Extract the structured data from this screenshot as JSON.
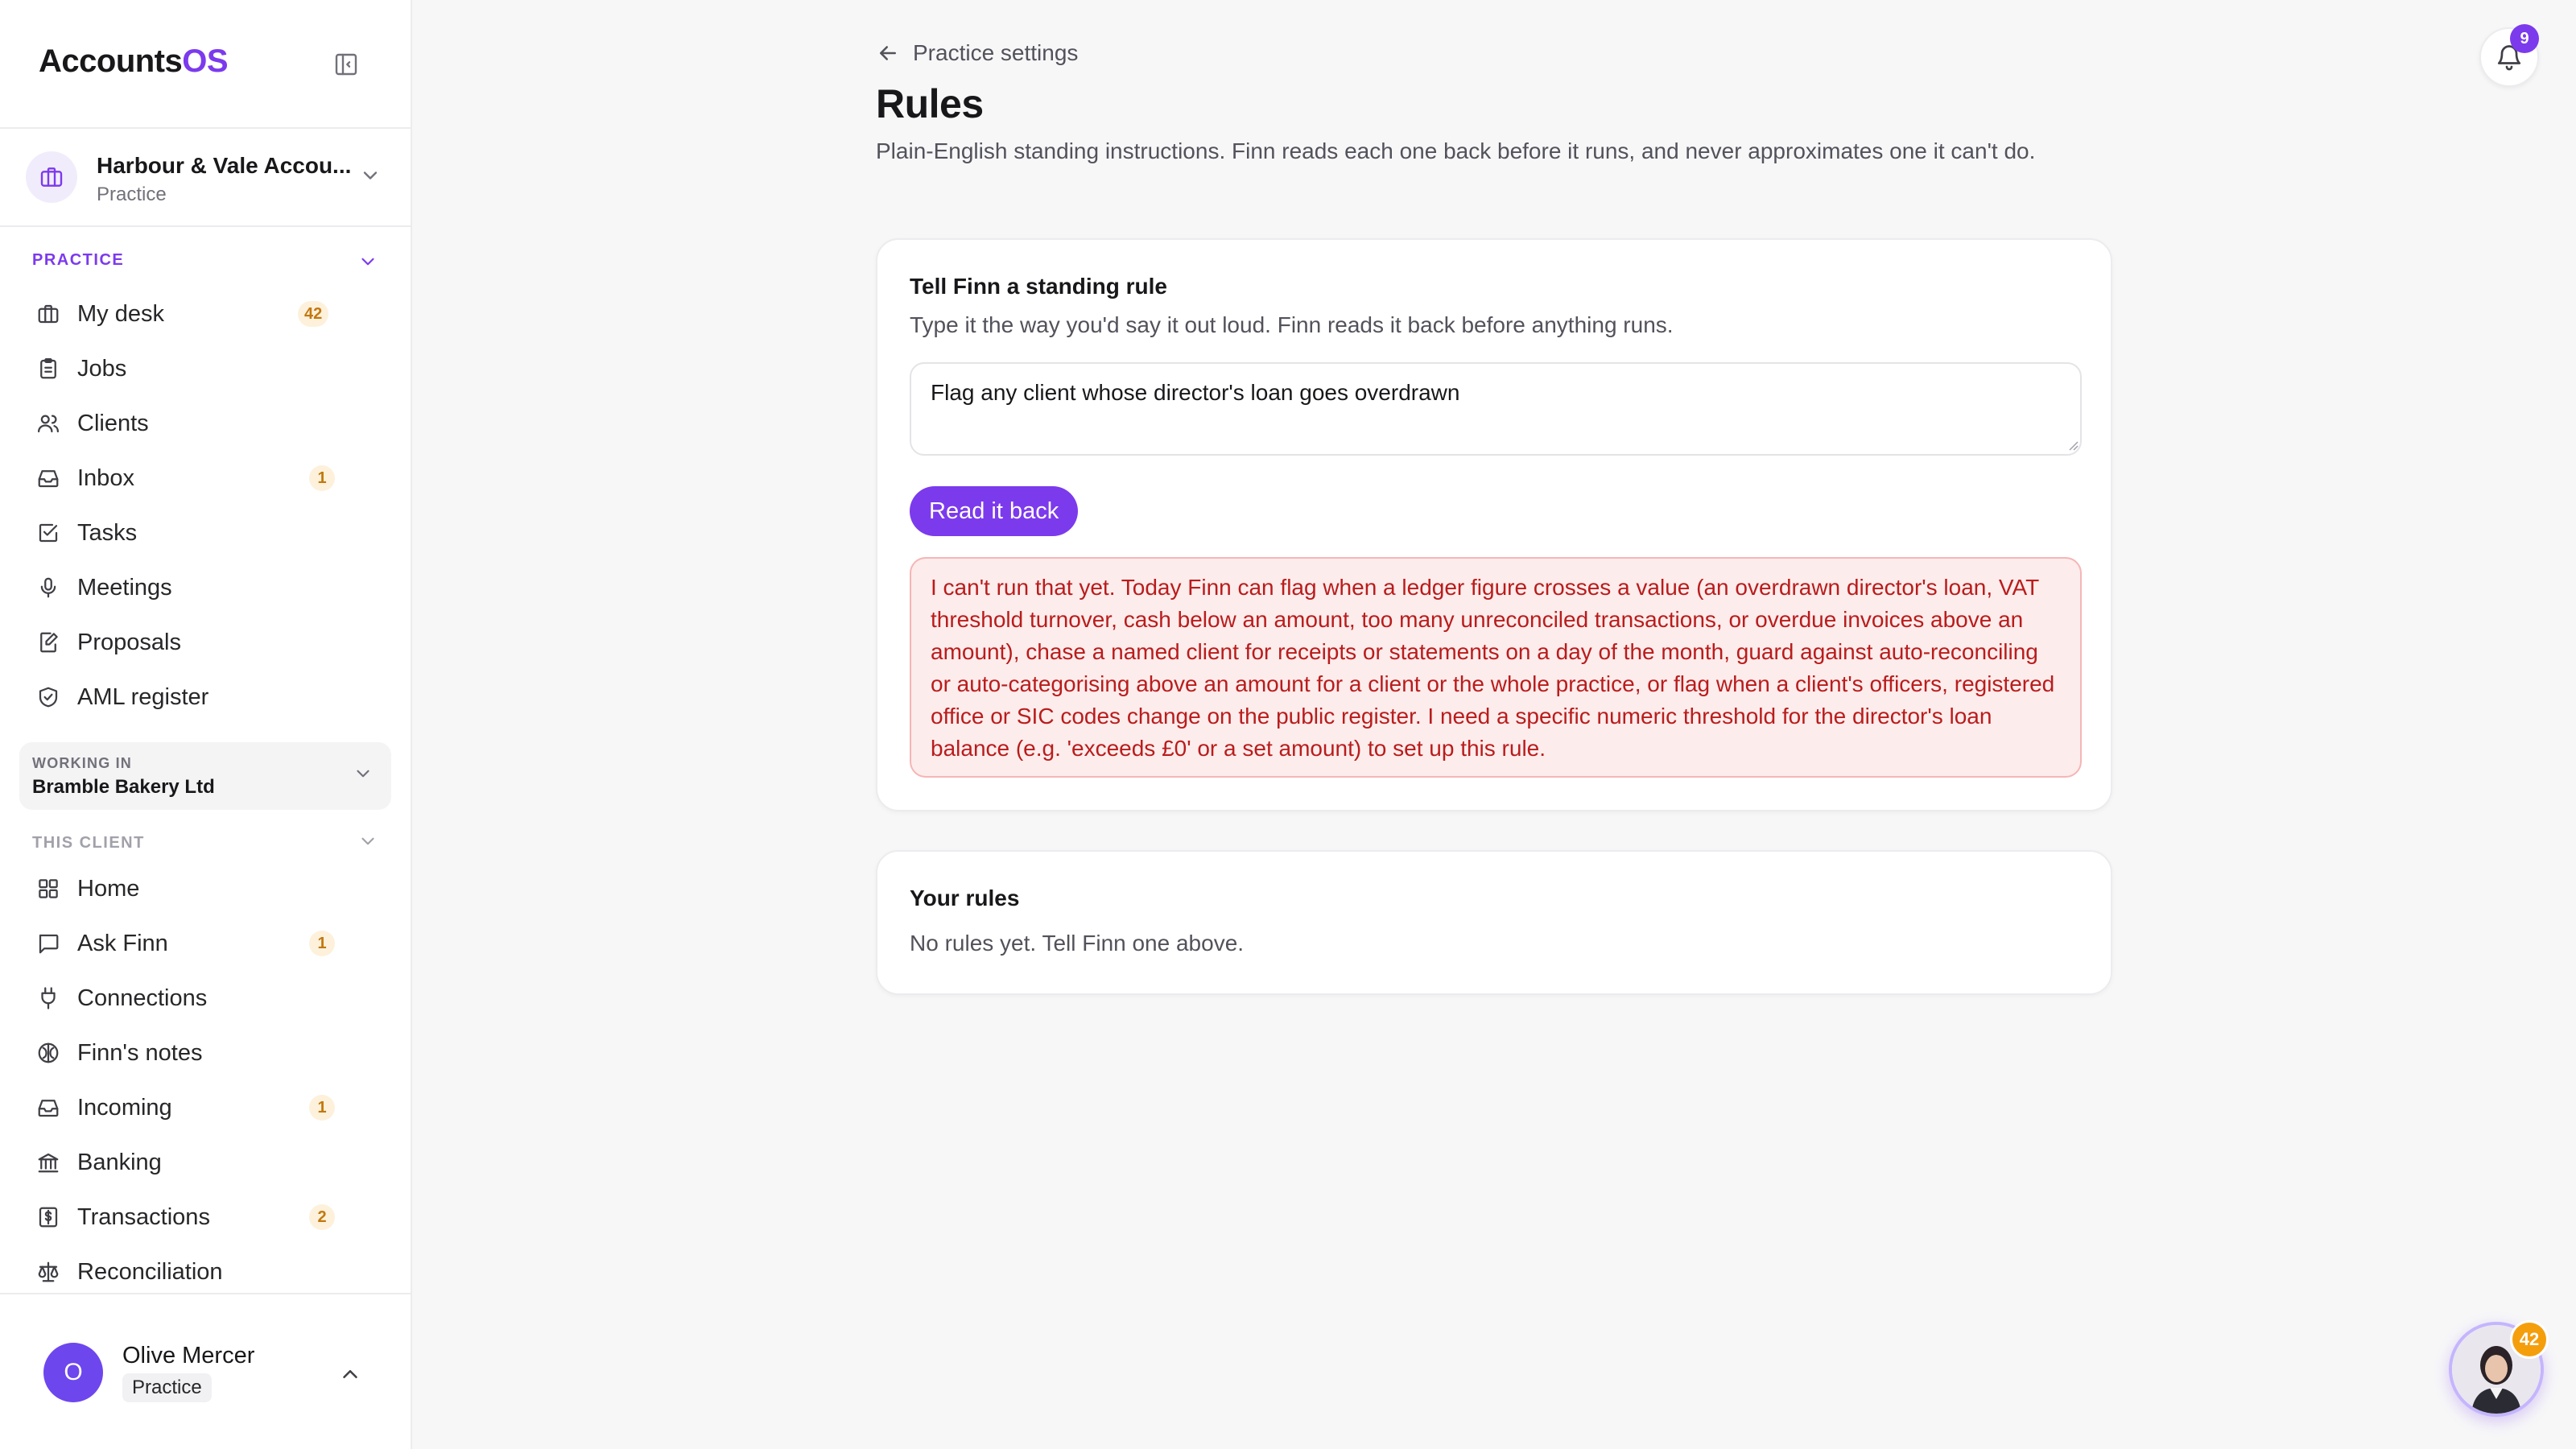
{
  "brand": {
    "name": "Accounts",
    "suffix": "OS",
    "accent": "#7c3aed"
  },
  "practice": {
    "name": "Harbour & Vale Accou...",
    "sub": "Practice"
  },
  "sections": {
    "practice": "PRACTICE",
    "this_client": "THIS CLIENT"
  },
  "practice_nav": [
    {
      "label": "My desk",
      "icon": "briefcase-icon",
      "badge": "42"
    },
    {
      "label": "Jobs",
      "icon": "clipboard-icon",
      "badge": ""
    },
    {
      "label": "Clients",
      "icon": "users-icon",
      "badge": ""
    },
    {
      "label": "Inbox",
      "icon": "inbox-icon",
      "badge": "1"
    },
    {
      "label": "Tasks",
      "icon": "checkbox-icon",
      "badge": ""
    },
    {
      "label": "Meetings",
      "icon": "microphone-icon",
      "badge": ""
    },
    {
      "label": "Proposals",
      "icon": "edit-document-icon",
      "badge": ""
    },
    {
      "label": "AML register",
      "icon": "shield-check-icon",
      "badge": ""
    }
  ],
  "working_in": {
    "label": "WORKING IN",
    "value": "Bramble Bakery Ltd"
  },
  "client_nav": [
    {
      "label": "Home",
      "icon": "grid-icon",
      "badge": ""
    },
    {
      "label": "Ask Finn",
      "icon": "chat-icon",
      "badge": "1"
    },
    {
      "label": "Connections",
      "icon": "plug-icon",
      "badge": ""
    },
    {
      "label": "Finn's notes",
      "icon": "brain-icon",
      "badge": ""
    },
    {
      "label": "Incoming",
      "icon": "inbox-icon",
      "badge": "1"
    },
    {
      "label": "Banking",
      "icon": "bank-icon",
      "badge": ""
    },
    {
      "label": "Transactions",
      "icon": "receipt-icon",
      "badge": "2"
    },
    {
      "label": "Reconciliation",
      "icon": "scale-icon",
      "badge": ""
    }
  ],
  "user": {
    "initial": "O",
    "name": "Olive Mercer",
    "role": "Practice"
  },
  "header": {
    "back_label": "Practice settings",
    "title": "Rules",
    "description": "Plain-English standing instructions. Finn reads each one back before it runs, and never approximates one it can't do."
  },
  "notifications": {
    "count": "9"
  },
  "rule_card": {
    "title": "Tell Finn a standing rule",
    "subtitle": "Type it the way you'd say it out loud. Finn reads it back before anything runs.",
    "input_value": "Flag any client whose director's loan goes overdrawn",
    "button_label": "Read it back",
    "error": "I can't run that yet. Today Finn can flag when a ledger figure crosses a value (an overdrawn director's loan, VAT threshold turnover, cash below an amount, too many unreconciled transactions, or overdue invoices above an amount), chase a named client for receipts or statements on a day of the month, guard against auto-reconciling or auto-categorising above an amount for a client or the whole practice, or flag when a client's officers, registered office or SIC codes change on the public register. I need a specific numeric threshold for the director's loan balance (e.g. 'exceeds £0' or a set amount) to set up this rule."
  },
  "rules_card": {
    "title": "Your rules",
    "empty": "No rules yet. Tell Finn one above."
  },
  "assistant": {
    "badge": "42"
  }
}
